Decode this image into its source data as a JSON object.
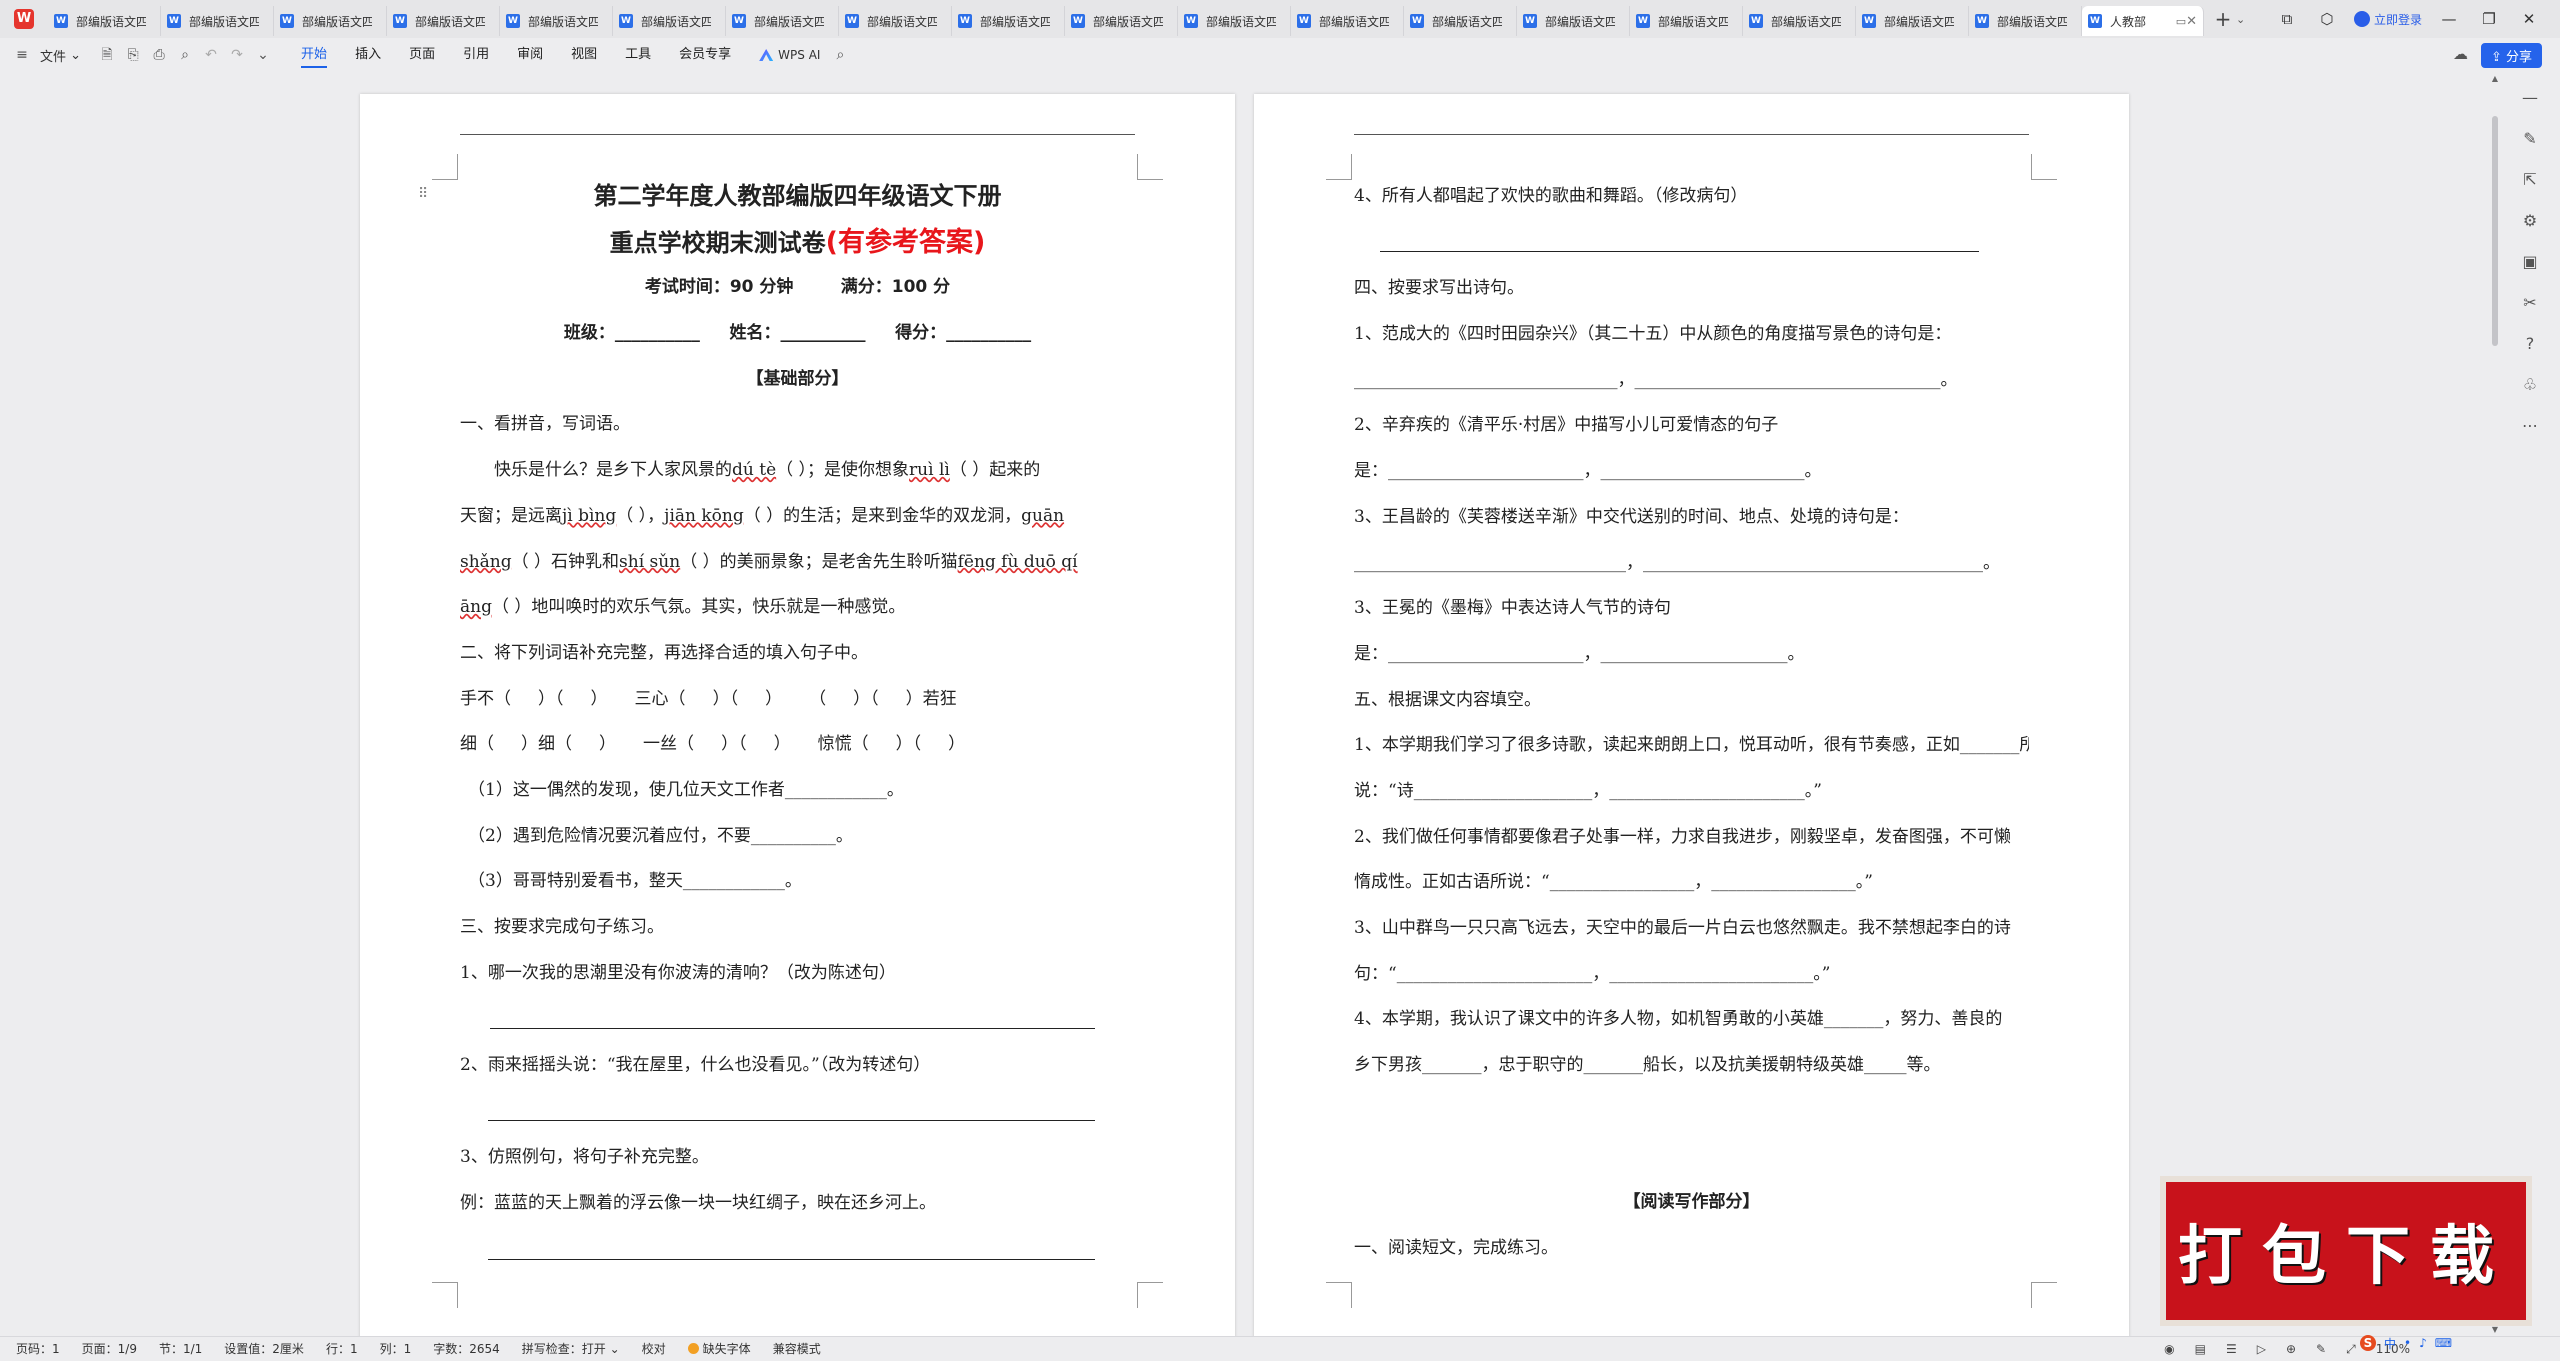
{
  "app": {
    "logo_text": "W",
    "tabs": [
      {
        "label": "部编版语文四年级下册"
      },
      {
        "label": "部编版语文四年级下册"
      },
      {
        "label": "部编版语文四年级下册"
      },
      {
        "label": "部编版语文四年级下册"
      },
      {
        "label": "部编版语文四年级下册"
      },
      {
        "label": "部编版语文四年级下册"
      },
      {
        "label": "部编版语文四年级下册"
      },
      {
        "label": "部编版语文四年级下册"
      },
      {
        "label": "部编版语文四年级下册"
      },
      {
        "label": "部编版语文四年级下册"
      },
      {
        "label": "部编版语文四年级下册"
      },
      {
        "label": "部编版语文四年级下册"
      },
      {
        "label": "部编版语文四年级下册"
      },
      {
        "label": "部编版语文四年级下册"
      },
      {
        "label": "部编版语文四年级下册"
      },
      {
        "label": "部编版语文四年级下册"
      },
      {
        "label": "部编版语文四年级下册"
      },
      {
        "label": "部编版语文四年级下册"
      }
    ],
    "active_tab": "人教部",
    "login_label": "立即登录"
  },
  "toolbar": {
    "file_label": "文件",
    "menus": [
      "开始",
      "插入",
      "页面",
      "引用",
      "审阅",
      "视图",
      "工具",
      "会员专享"
    ],
    "wps_ai_label": "WPS AI",
    "share_label": "分享"
  },
  "doc": {
    "title_line1": "第二学年度人教部编版四年级语文下册",
    "title_line2_black": "重点学校期末测试卷",
    "title_line2_red": "(有参考答案)",
    "exam_info": "考试时间：90 分钟        满分：100 分",
    "student_line": "班级：__________     姓名：__________     得分：__________",
    "section_basic": "【基础部分】",
    "q1_title": "一、看拼音，写词语。",
    "q1_p1": "快乐是什么？是乡下人家风景的",
    "q1_py1": "dú tè",
    "q1_p2": "（     ）；是使你想象",
    "q1_py2": "ruì lì",
    "q1_p3": "（     ）起来的",
    "q1_l2a": "天窗；是远离",
    "q1_py3": "jì bìng",
    "q1_l2b": "（     ），",
    "q1_py4": "jiān kōng",
    "q1_l2c": "（     ）的生活；是来到金华的双龙洞，",
    "q1_py5": "guān",
    "q1_py5b": "shǎng",
    "q1_l3a": "（     ）石钟乳和",
    "q1_py6": "shí sǔn",
    "q1_l3b": "（     ）的美丽景象；是老舍先生聆听猫",
    "q1_py7": "fēng fù duō qí",
    "q1_py7b": "āng",
    "q1_l4": "（     ）地叫唤时的欢乐气氛。其实，快乐就是一种感觉。",
    "q2_title": "二、将下列词语补充完整，再选择合适的填入句子中。",
    "q2_row1": "手不（     ）（     ）     三心（     ）（     ）     （     ）（     ）若狂",
    "q2_row2": "细（     ）细（     ）     一丝（     ）（     ）     惊慌（     ）（     ）",
    "q2_s1": "（1）这一偶然的发现，使几位天文工作者____________。",
    "q2_s2": "（2）遇到危险情况要沉着应付，不要__________。",
    "q2_s3": "（3）哥哥特别爱看书，整天____________。",
    "q3_title": "三、按要求完成句子练习。",
    "q3_1": "1、哪一次我的思潮里没有你波涛的清响？（改为陈述句）",
    "q3_2": "2、雨来摇摇头说：“我在屋里，什么也没看见。”（改为转述句）",
    "q3_3": "3、仿照例句，将句子补充完整。",
    "q3_ex": "例：蓝蓝的天上飘着的浮云像一块一块红绸子，映在还乡河上。",
    "p2_q4": "4、所有人都唱起了欢快的歌曲和舞蹈。（修改病句）",
    "p2_s4": "四、按要求写出诗句。",
    "p2_s4_1": "1、范成大的《四时田园杂兴》（其二十五）中从颜色的角度描写景色的诗句是：",
    "p2_s4_1a": "_______________________________，____________________________________。",
    "p2_s4_2": "2、辛弃疾的《清平乐·村居》中描写小儿可爱情态的句子",
    "p2_s4_2a": "是：_______________________，________________________。",
    "p2_s4_3": "3、王昌龄的《芙蓉楼送辛渐》中交代送别的时间、地点、处境的诗句是：",
    "p2_s4_3a": "________________________________，________________________________________。",
    "p2_s4_4": "3、王冕的《墨梅》中表达诗人气节的诗句",
    "p2_s4_4a": "是：_______________________，______________________。",
    "p2_s5": "五、根据课文内容填空。",
    "p2_s5_1": "1、本学期我们学习了很多诗歌，读起来朗朗上口，悦耳动听，很有节奏感，正如_______所",
    "p2_s5_1b": "说：“诗_____________________，_______________________。”",
    "p2_s5_2": "2、我们做任何事情都要像君子处事一样，力求自我进步，刚毅坚卓，发奋图强，不可懒",
    "p2_s5_2b": "惰成性。正如古语所说：“_________________，_________________。”",
    "p2_s5_3": "3、山中群鸟一只只高飞远去，天空中的最后一片白云也悠然飘走。我不禁想起李白的诗",
    "p2_s5_3b": "句：“_______________________，________________________。”",
    "p2_s5_4": "4、本学期，我认识了课文中的许多人物，如机智勇敢的小英雄_______，努力、善良的",
    "p2_s5_4b": "乡下男孩_______，忠于职守的_______船长，以及抗美援朝特级英雄_____等。",
    "section_reading": "【阅读写作部分】",
    "reading_1": "一、阅读短文，完成练习。"
  },
  "status": {
    "page": "页码：1",
    "pages": "页面：1/9",
    "section": "节：1/1",
    "setting": "设置值：2厘米",
    "row": "行：1",
    "col": "列：1",
    "words": "字数：2654",
    "spell": "拼写检查：打开",
    "proof": "校对",
    "missing_font": "缺失字体",
    "compat": "兼容模式",
    "zoom": "110%"
  },
  "promo": {
    "text": "打包下载"
  },
  "ime": {
    "label": "中"
  }
}
